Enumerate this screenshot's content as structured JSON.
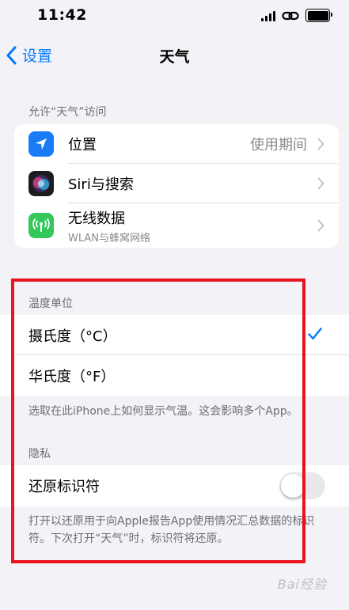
{
  "status_bar": {
    "time": "11:42"
  },
  "nav": {
    "back_label": "设置",
    "title": "天气"
  },
  "allow_access": {
    "header": "允许“天气”访问",
    "rows": [
      {
        "label": "位置",
        "value": "使用期间",
        "icon": "location-arrow-icon",
        "icon_color": "#1a7cf5"
      },
      {
        "label": "Siri与搜索",
        "icon": "siri-icon",
        "icon_color": "#1c1c1e"
      },
      {
        "label": "无线数据",
        "sublabel": "WLAN与蜂窝网络",
        "icon": "antenna-icon",
        "icon_color": "#34c759"
      }
    ]
  },
  "temperature_unit": {
    "header": "温度单位",
    "options": [
      {
        "label": "摄氏度（°C）",
        "selected": true
      },
      {
        "label": "华氏度（°F）",
        "selected": false
      }
    ],
    "footer": "选取在此iPhone上如何显示气温。这会影响多个App。"
  },
  "privacy": {
    "header": "隐私",
    "reset_label": "还原标识符",
    "reset_enabled": false,
    "footer": "打开以还原用于向Apple报告App使用情况汇总数据的标识符。下次打开“天气”时，标识符将还原。"
  },
  "watermark": "Bai经验",
  "colors": {
    "accent": "#007aff",
    "highlight_border": "#e8141e"
  }
}
